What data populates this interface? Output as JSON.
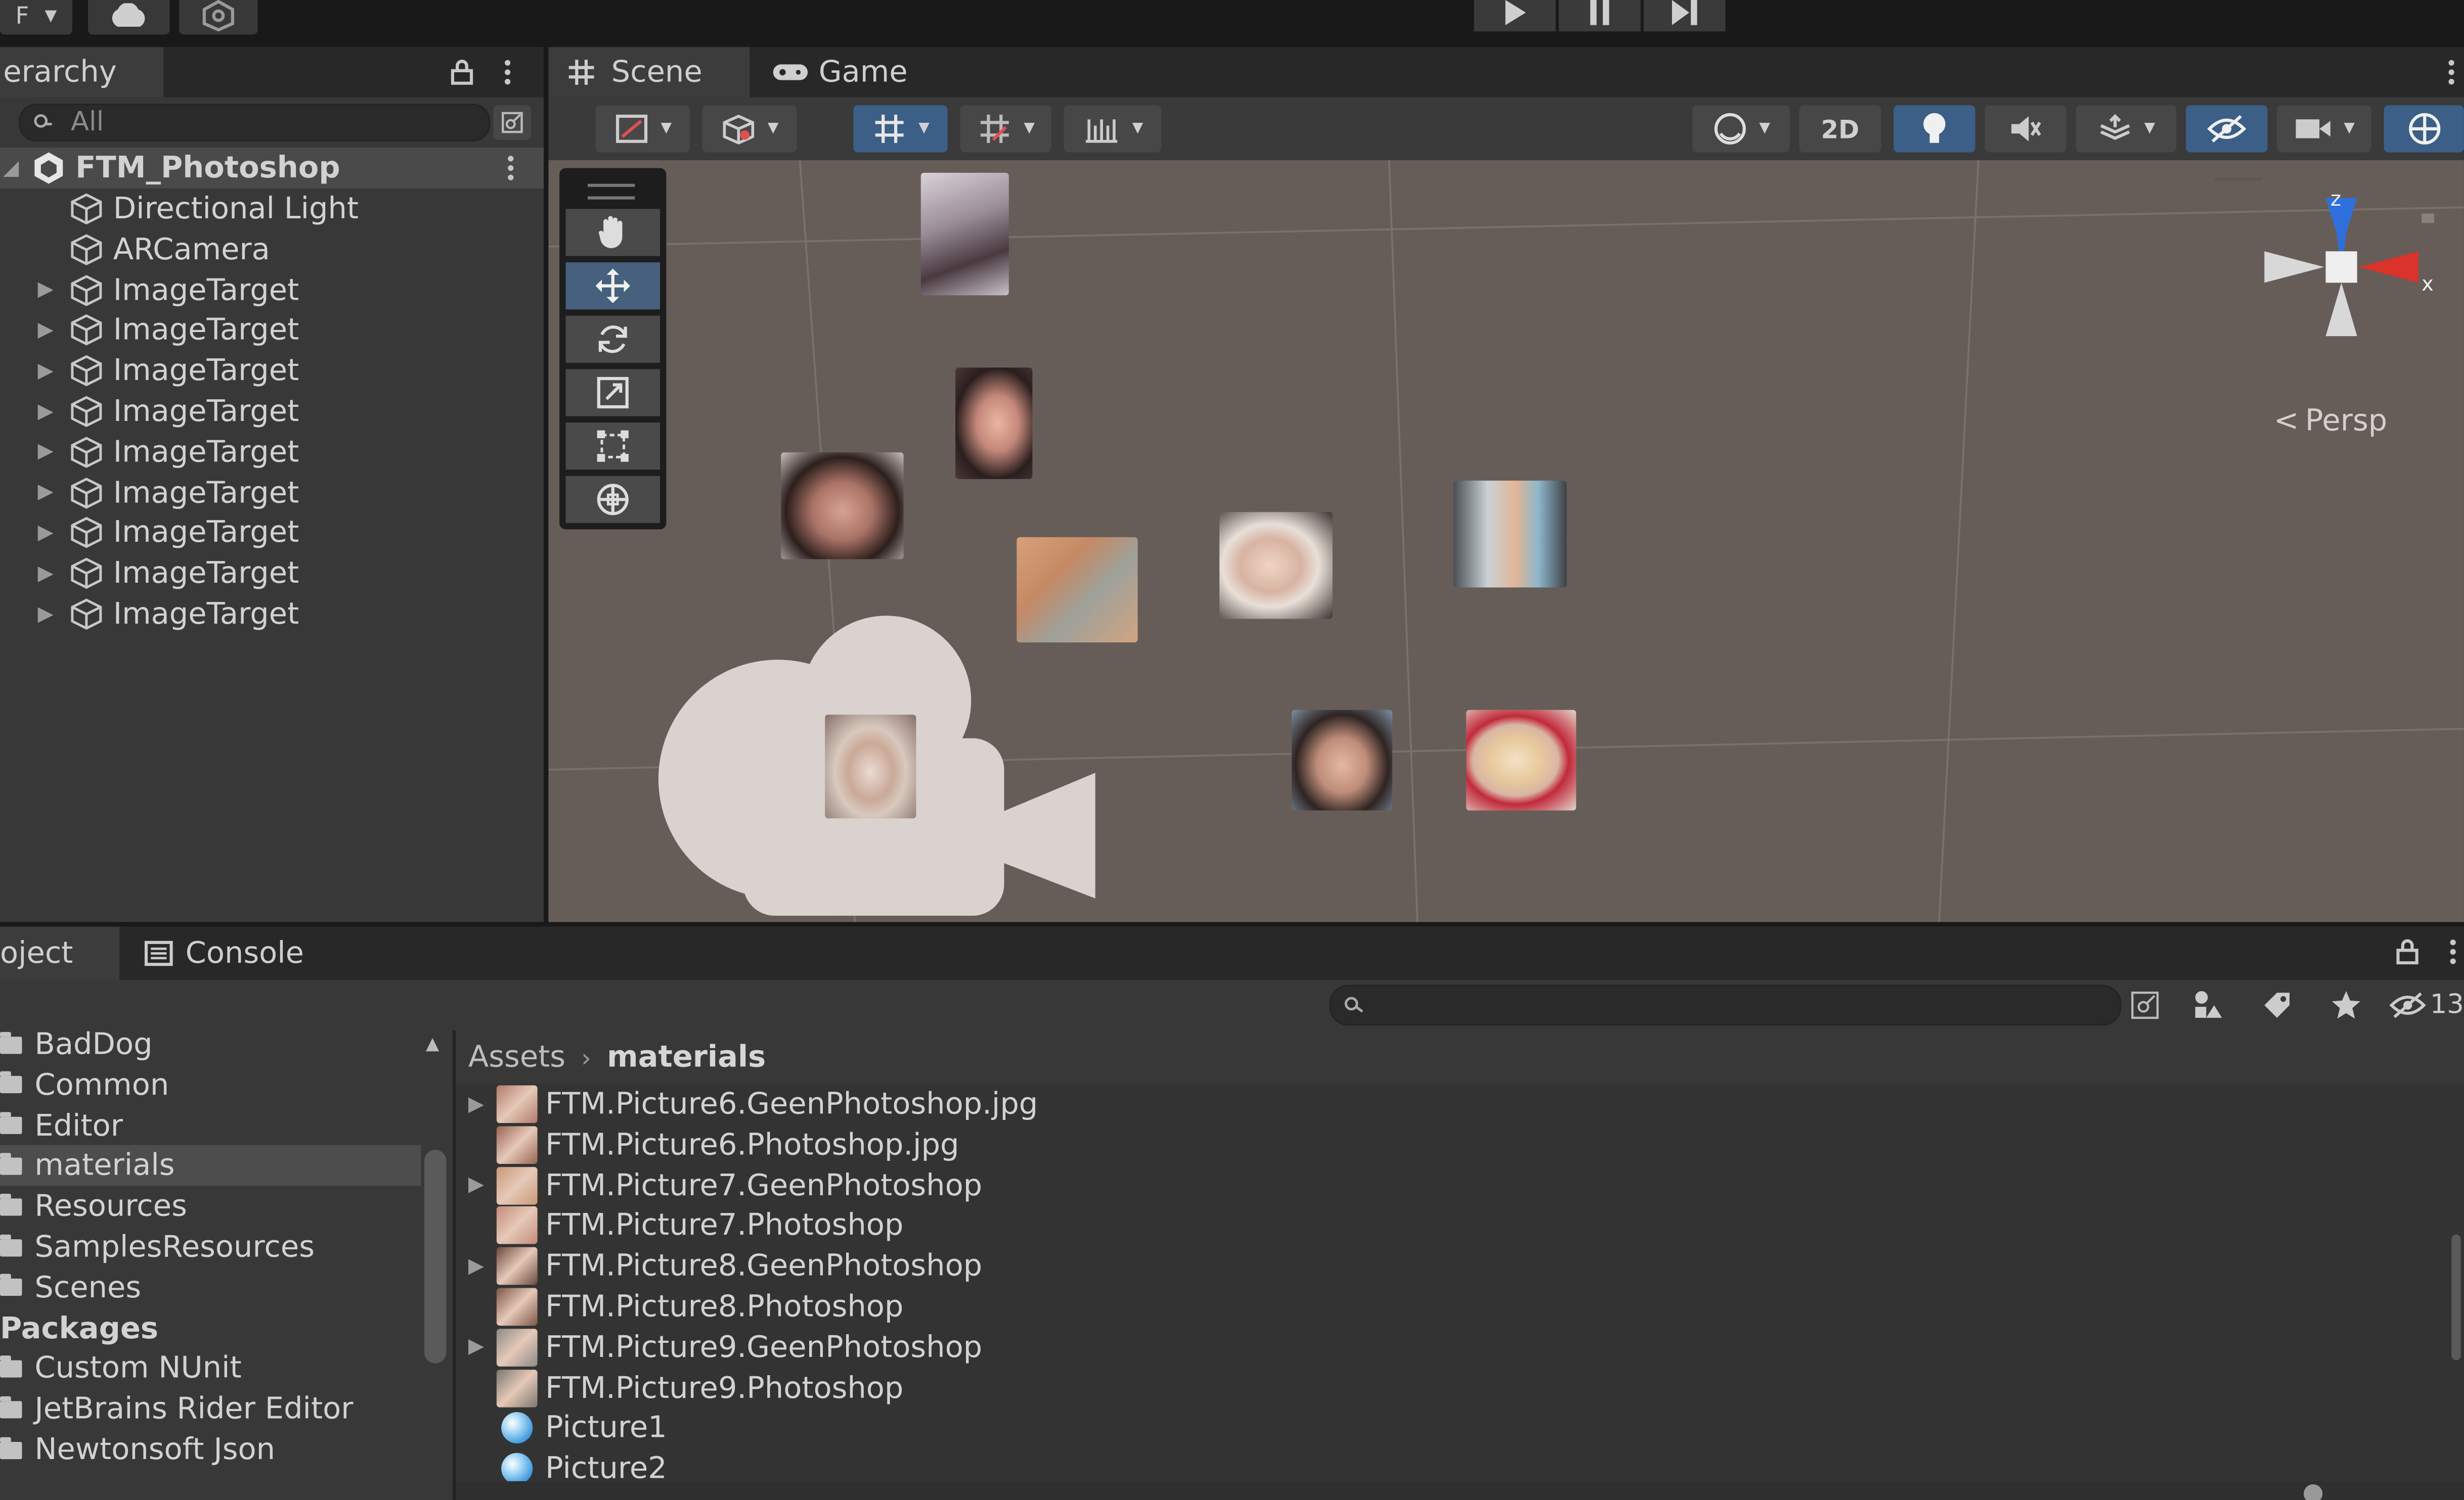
{
  "top_toolbar": {
    "dropdown_label": "F",
    "play_icon": "play-icon",
    "pause_icon": "pause-icon",
    "step_icon": "step-icon"
  },
  "hierarchy": {
    "tab_label": "erarchy",
    "search_placeholder": "All",
    "scene_name": "FTM_Photoshop",
    "items": [
      {
        "label": "Directional Light",
        "expandable": false
      },
      {
        "label": "ARCamera",
        "expandable": false
      },
      {
        "label": "ImageTarget",
        "expandable": true
      },
      {
        "label": "ImageTarget",
        "expandable": true
      },
      {
        "label": "ImageTarget",
        "expandable": true
      },
      {
        "label": "ImageTarget",
        "expandable": true
      },
      {
        "label": "ImageTarget",
        "expandable": true
      },
      {
        "label": "ImageTarget",
        "expandable": true
      },
      {
        "label": "ImageTarget",
        "expandable": true
      },
      {
        "label": "ImageTarget",
        "expandable": true
      },
      {
        "label": "ImageTarget",
        "expandable": true
      }
    ]
  },
  "scene": {
    "tabs": [
      {
        "label": "Scene",
        "icon": "grid-hash-icon"
      },
      {
        "label": "Game",
        "icon": "gamepad-icon"
      }
    ],
    "toolbar_2d_label": "2D",
    "gizmo": {
      "z_label": "z",
      "x_label": "x",
      "persp_label": "Persp"
    },
    "colors": {
      "axis_z": "#2f6fdc",
      "axis_x": "#d9332c",
      "viewport_bg": "#675d58",
      "selected_tool": "#46607e"
    }
  },
  "project": {
    "tabs": [
      {
        "label": "oject"
      },
      {
        "label": "Console",
        "icon": "console-icon"
      }
    ],
    "hidden_count": "13",
    "breadcrumb": {
      "root": "Assets",
      "current": "materials"
    },
    "folders": [
      {
        "label": "BadDog",
        "type": "folder"
      },
      {
        "label": "Common",
        "type": "folder"
      },
      {
        "label": "Editor",
        "type": "folder"
      },
      {
        "label": "materials",
        "type": "folder",
        "selected": true
      },
      {
        "label": "Resources",
        "type": "folder"
      },
      {
        "label": "SamplesResources",
        "type": "folder"
      },
      {
        "label": "Scenes",
        "type": "folder"
      },
      {
        "label": "Packages",
        "type": "header"
      },
      {
        "label": "Custom NUnit",
        "type": "folder"
      },
      {
        "label": "JetBrains Rider Editor",
        "type": "folder"
      },
      {
        "label": "Newtonsoft Json",
        "type": "folder"
      }
    ],
    "assets": [
      {
        "label": "FTM.Picture6.GeenPhotoshop.jpg",
        "expandable": true,
        "thumb_color": "#b07a6a"
      },
      {
        "label": "FTM.Picture6.Photoshop.jpg",
        "expandable": false,
        "thumb_color": "#9a6455"
      },
      {
        "label": "FTM.Picture7.GeenPhotoshop",
        "expandable": true,
        "thumb_color": "#c99877"
      },
      {
        "label": "FTM.Picture7.Photoshop",
        "expandable": false,
        "thumb_color": "#c48b78"
      },
      {
        "label": "FTM.Picture8.GeenPhotoshop",
        "expandable": true,
        "thumb_color": "#6a4a40"
      },
      {
        "label": "FTM.Picture8.Photoshop",
        "expandable": false,
        "thumb_color": "#7d5547"
      },
      {
        "label": "FTM.Picture9.GeenPhotoshop",
        "expandable": true,
        "thumb_color": "#8d8a86"
      },
      {
        "label": "FTM.Picture9.Photoshop",
        "expandable": false,
        "thumb_color": "#7b766f"
      },
      {
        "label": "Picture1",
        "expandable": false,
        "thumb_color": "material"
      },
      {
        "label": "Picture2",
        "expandable": false,
        "thumb_color": "material"
      }
    ]
  }
}
